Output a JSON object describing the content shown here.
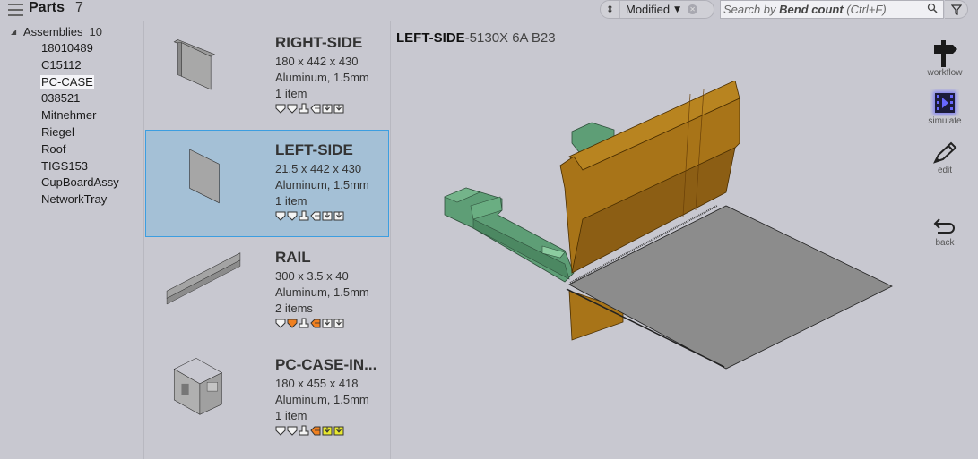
{
  "header": {
    "title": "Parts",
    "count": "7",
    "sort": {
      "value": "Modified"
    },
    "search": {
      "placeholder_prefix": "Search by ",
      "placeholder_bold": "Bend count",
      "placeholder_suffix": " (Ctrl+F)"
    }
  },
  "tree": {
    "root_label": "Assemblies",
    "root_count": "10",
    "items": [
      {
        "label": "18010489",
        "selected": false
      },
      {
        "label": "C15112",
        "selected": false
      },
      {
        "label": "PC-CASE",
        "selected": true
      },
      {
        "label": "038521",
        "selected": false
      },
      {
        "label": "Mitnehmer",
        "selected": false
      },
      {
        "label": "Riegel",
        "selected": false
      },
      {
        "label": "Roof",
        "selected": false
      },
      {
        "label": "TIGS153",
        "selected": false
      },
      {
        "label": "CupBoardAssy",
        "selected": false
      },
      {
        "label": "NetworkTray",
        "selected": false
      }
    ]
  },
  "parts": [
    {
      "name": "RIGHT-SIDE",
      "dims": "180 x 442 x 430",
      "material": "Aluminum, 1.5mm",
      "qty": "1 item",
      "selected": false,
      "ops": [
        "white",
        "white",
        "white",
        "white",
        "white",
        "white"
      ]
    },
    {
      "name": "LEFT-SIDE",
      "dims": "21.5 x 442 x 430",
      "material": "Aluminum, 1.5mm",
      "qty": "1 item",
      "selected": true,
      "ops": [
        "white",
        "white",
        "white",
        "white",
        "white",
        "white"
      ]
    },
    {
      "name": "RAIL",
      "dims": "300 x 3.5 x 40",
      "material": "Aluminum, 1.5mm",
      "qty": "2 items",
      "selected": false,
      "ops": [
        "white",
        "orange",
        "white",
        "orange",
        "white",
        "white"
      ]
    },
    {
      "name": "PC-CASE-IN...",
      "dims": "180 x 455 x 418",
      "material": "Aluminum, 1.5mm",
      "qty": "1 item",
      "selected": false,
      "ops": [
        "white",
        "white",
        "white",
        "orange",
        "yellow",
        "yellow"
      ]
    }
  ],
  "op_icons": [
    "punch-icon",
    "die-icon",
    "tool-icon",
    "backgauge-icon",
    "bend-down-icon",
    "bend-down-icon"
  ],
  "op_colors": {
    "white": "#f4f4f4",
    "orange": "#f08020",
    "yellow": "#e8e830"
  },
  "viewer": {
    "title_bold": "LEFT-SIDE",
    "title_rest": "-5130X 6A B23"
  },
  "toolbar": {
    "workflow": "workflow",
    "simulate": "simulate",
    "edit": "edit",
    "back": "back"
  },
  "colors": {
    "accent_selected": "#3c9ee0",
    "selected_bg": "#a4c0d6",
    "tool_orange": "#a87418",
    "tool_green": "#5a9c70",
    "sheet_gray": "#8c8c8c",
    "simulate_glow": "#6060ff"
  }
}
